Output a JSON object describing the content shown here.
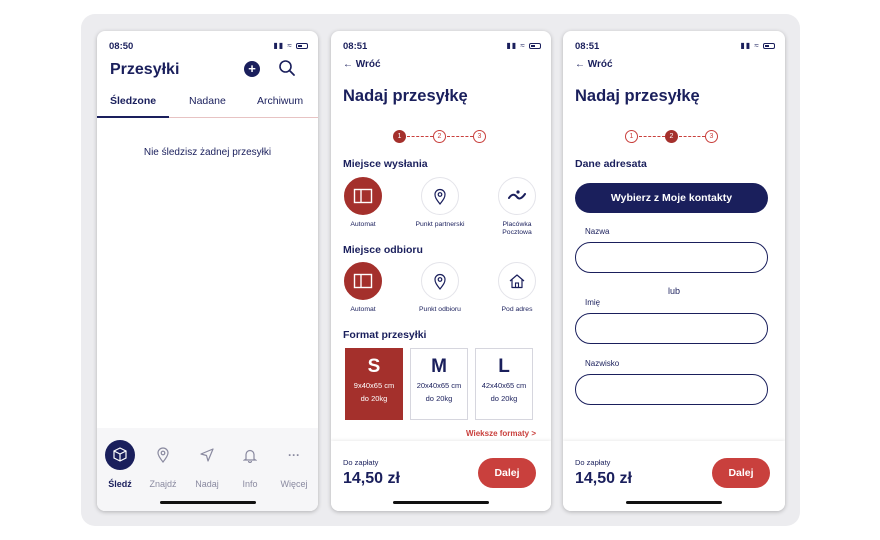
{
  "phone1": {
    "status": {
      "time": "08:50"
    },
    "title": "Przesyłki",
    "add_icon": "plus-icon",
    "search_icon": "search-icon",
    "tabs": [
      {
        "label": "Śledzone",
        "active": true
      },
      {
        "label": "Nadane",
        "active": false
      },
      {
        "label": "Archiwum",
        "active": false
      }
    ],
    "empty_message": "Nie śledzisz żadnej przesyłki",
    "nav": [
      {
        "label": "Śledź",
        "icon": "package-icon",
        "active": true
      },
      {
        "label": "Znajdź",
        "icon": "location-pin-icon",
        "active": false
      },
      {
        "label": "Nadaj",
        "icon": "send-icon",
        "active": false
      },
      {
        "label": "Info",
        "icon": "bell-icon",
        "active": false
      },
      {
        "label": "Więcej",
        "icon": "more-icon",
        "active": false
      }
    ]
  },
  "phone2": {
    "status": {
      "time": "08:51"
    },
    "back_label": "Wróć",
    "title": "Nadaj przesyłkę",
    "steps": [
      "1",
      "2",
      "3"
    ],
    "active_step": 1,
    "send_section": "Miejsce wysłania",
    "send_options": [
      {
        "label": "Automat",
        "icon": "parcel-locker-icon",
        "active": true
      },
      {
        "label": "Punkt partnerski",
        "icon": "location-pin-icon",
        "active": false
      },
      {
        "label": "Placówka Pocztowa",
        "icon": "post-office-icon",
        "active": false
      }
    ],
    "receive_section": "Miejsce odbioru",
    "receive_options": [
      {
        "label": "Automat",
        "icon": "parcel-locker-icon",
        "active": true
      },
      {
        "label": "Punkt odbioru",
        "icon": "location-pin-icon",
        "active": false
      },
      {
        "label": "Pod adres",
        "icon": "home-icon",
        "active": false
      }
    ],
    "format_section": "Format przesyłki",
    "formats": [
      {
        "size": "S",
        "dims": "9x40x65 cm",
        "weight": "do 20kg",
        "active": true
      },
      {
        "size": "M",
        "dims": "20x40x65 cm",
        "weight": "do 20kg",
        "active": false
      },
      {
        "size": "L",
        "dims": "42x40x65 cm",
        "weight": "do 20kg",
        "active": false
      }
    ],
    "more_formats": "Wieksze formaty >",
    "pay_label": "Do zapłaty",
    "pay_amount": "14,50 zł",
    "next_label": "Dalej"
  },
  "phone3": {
    "status": {
      "time": "08:51"
    },
    "back_label": "Wróć",
    "title": "Nadaj przesyłkę",
    "steps": [
      "1",
      "2",
      "3"
    ],
    "active_step": 2,
    "section": "Dane adresata",
    "contacts_button": "Wybierz z Moje kontakty",
    "name_label": "Nazwa",
    "or_label": "lub",
    "first_name_label": "Imię",
    "last_name_label": "Nazwisko",
    "pay_label": "Do zapłaty",
    "pay_amount": "14,50 zł",
    "next_label": "Dalej"
  },
  "colors": {
    "navy": "#1a1f5c",
    "red": "#a4302c",
    "accent_red": "#c9403d"
  }
}
